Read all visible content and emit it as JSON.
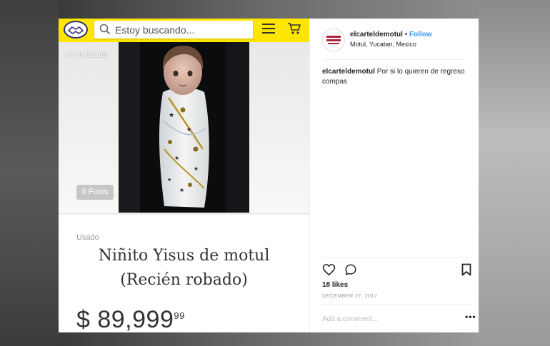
{
  "marketplace": {
    "search_placeholder": "Estoy buscando...",
    "back_label": "Ir al listado",
    "photos_count": "6 Fotos",
    "condition": "Usado",
    "title_line1": "Niñito Yisus de motul",
    "title_line2": "(Recién robado)",
    "price_main": "$ 89,999",
    "price_cents": "99"
  },
  "instagram": {
    "username": "elcarteldemotul",
    "separator": " • ",
    "follow_label": "Follow",
    "location": "Motul, Yucatan, Mexico",
    "caption_user": "elcarteldemotul",
    "caption_text": "Por si lo quieren de regreso compas",
    "likes": "18 likes",
    "date": "DECEMBER 27, 2017",
    "add_comment_placeholder": "Add a comment...",
    "more_label": "•••"
  },
  "colors": {
    "ml_yellow": "#ffe600",
    "ml_blue": "#2d3277",
    "ig_link": "#3897f0"
  },
  "icons": [
    "handshake-logo-icon",
    "search-icon",
    "hamburger-menu-icon",
    "cart-icon",
    "chevron-left-icon",
    "heart-icon",
    "comment-icon",
    "bookmark-icon",
    "more-icon"
  ]
}
